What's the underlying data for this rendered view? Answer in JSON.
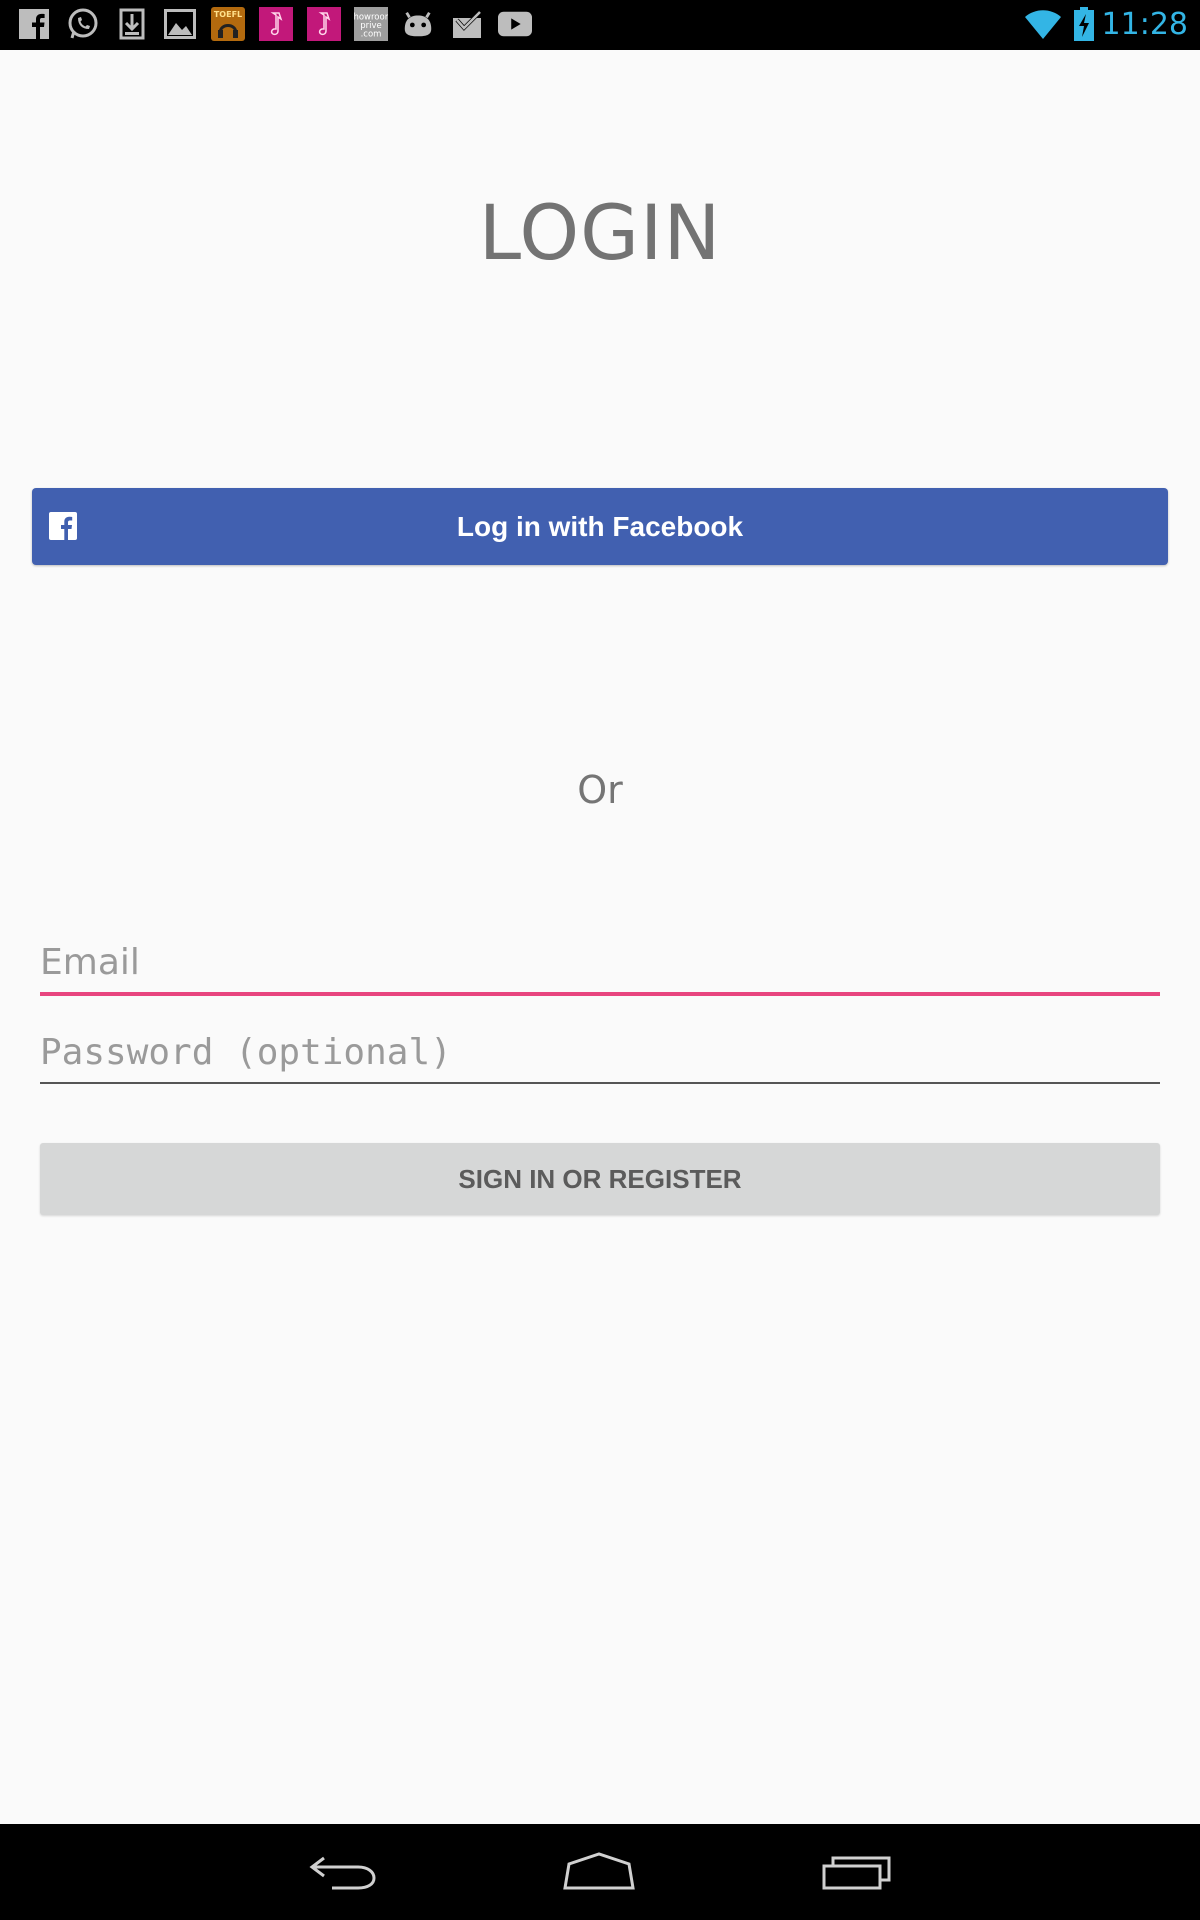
{
  "status_bar": {
    "time": "11:28",
    "time_color": "#33b5e5",
    "notification_icons": [
      "facebook-icon",
      "whatsapp-icon",
      "download-icon",
      "gallery-icon",
      "toefl-app-icon",
      "music-app-icon",
      "music-app-icon",
      "showroomprive-icon",
      "android-icon",
      "tasks-icon",
      "youtube-icon"
    ],
    "showroomprive_icon_text": "showroom prive .com",
    "toefl_icon_text": "TOEFL",
    "system_icons": [
      "wifi-icon",
      "battery-charging-icon"
    ]
  },
  "page": {
    "title": "LOGIN"
  },
  "facebook_button": {
    "label": "Log in with Facebook",
    "color": "#4160b0"
  },
  "separator": {
    "text": "Or"
  },
  "form": {
    "email_placeholder": "Email",
    "email_value": "",
    "password_placeholder": "Password (optional)",
    "password_value": "",
    "focus_color": "#e8457f"
  },
  "signin_button": {
    "label": "SIGN IN OR REGISTER"
  },
  "nav_bar": {
    "buttons": [
      "back-icon",
      "home-icon",
      "recent-apps-icon"
    ]
  }
}
